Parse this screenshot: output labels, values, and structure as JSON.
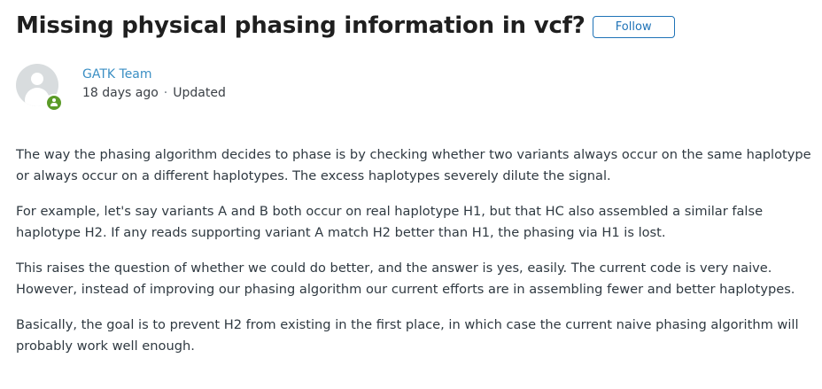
{
  "article": {
    "title": "Missing physical phasing information in vcf?",
    "follow_label": "Follow"
  },
  "author": {
    "name": "GATK Team",
    "time_ago": "18 days ago",
    "separator": "·",
    "status": "Updated",
    "avatar_icon": "user-avatar-icon",
    "badge_icon": "team-member-badge-icon",
    "badge_color": "#5b9b28"
  },
  "body": {
    "paragraphs": [
      "The way the phasing algorithm decides to phase is by checking whether two variants always occur on the same haplotype or always occur on a different haplotypes. The excess haplotypes severely dilute the signal.",
      "For example, let's say variants A and B both occur on real haplotype H1, but that HC also assembled a similar false haplotype H2. If any reads supporting variant A match H2 better than H1, the phasing via H1 is lost.",
      "This raises the question of whether we could do better, and the answer is yes, easily. The current code is very naive. However, instead of improving our phasing algorithm our current efforts are in assembling fewer and better haplotypes.",
      "Basically, the goal is to prevent H2 from existing in the first place, in which case the current naive phasing algorithm will probably work well enough."
    ]
  },
  "colors": {
    "accent": "#1f73b7",
    "author_link": "#3b8fc4",
    "text": "#2f3941"
  }
}
